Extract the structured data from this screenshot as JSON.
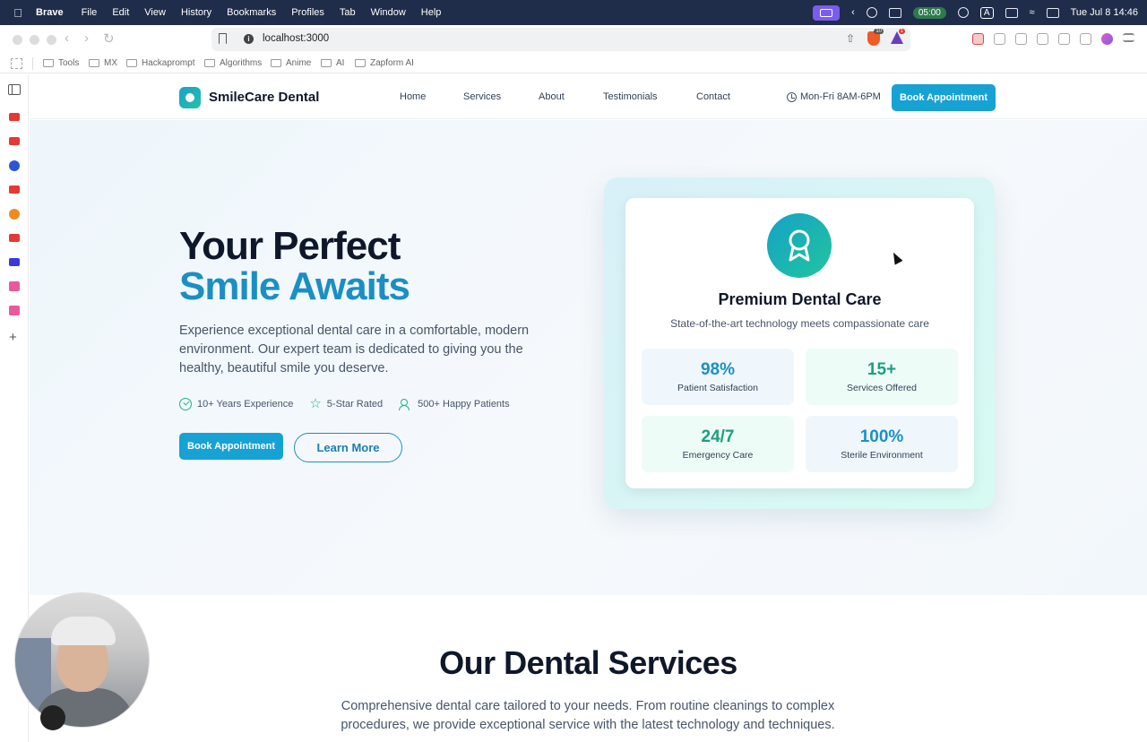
{
  "menubar": {
    "app": "Brave",
    "items": [
      "File",
      "Edit",
      "View",
      "History",
      "Bookmarks",
      "Profiles",
      "Tab",
      "Window",
      "Help"
    ],
    "timer": "05:00",
    "keyboard": "A",
    "clock": "Tue Jul 8  14:46"
  },
  "browser": {
    "url": "localhost:3000",
    "brave_badge": "10",
    "alert_badge": "1",
    "bookmarks": [
      "Tools",
      "MX",
      "Hackaprompt",
      "Algorithms",
      "Anime",
      "AI",
      "Zapform AI"
    ]
  },
  "site": {
    "brand": "SmileCare Dental",
    "nav": [
      "Home",
      "Services",
      "About",
      "Testimonials",
      "Contact"
    ],
    "hours": "Mon-Fri 8AM-6PM",
    "nav_cta": "Book Appointment",
    "hero": {
      "title_line1": "Your Perfect",
      "title_line2": "Smile Awaits",
      "lead": "Experience exceptional dental care in a comfortable, modern environment. Our expert team is dedicated to giving you the healthy, beautiful smile you deserve.",
      "features": [
        "10+ Years Experience",
        "5-Star Rated",
        "500+ Happy Patients"
      ],
      "primary_cta": "Book Appointment",
      "secondary_cta": "Learn More"
    },
    "card": {
      "title": "Premium Dental Care",
      "subtitle": "State-of-the-art technology meets compassionate care",
      "stats": [
        {
          "value": "98%",
          "label": "Patient Satisfaction"
        },
        {
          "value": "15+",
          "label": "Services Offered"
        },
        {
          "value": "24/7",
          "label": "Emergency Care"
        },
        {
          "value": "100%",
          "label": "Sterile Environment"
        }
      ]
    },
    "services": {
      "title": "Our Dental Services",
      "subtitle": "Comprehensive dental care tailored to your needs. From routine cleanings to complex procedures, we provide exceptional service with the latest technology and techniques."
    }
  },
  "colors": {
    "accent": "#17a2d4",
    "accent_dark": "#1b8fc4",
    "green": "#22b38c"
  }
}
